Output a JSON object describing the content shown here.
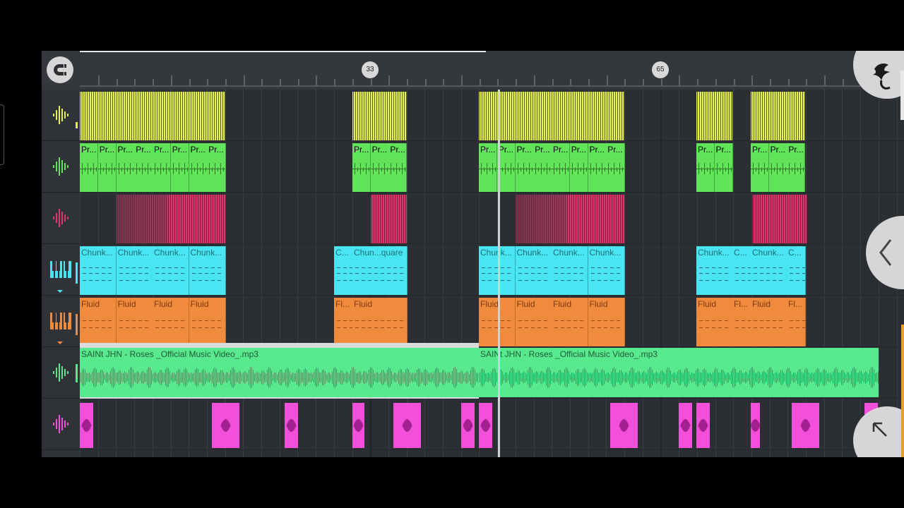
{
  "ruler": {
    "markers": [
      "33",
      "65"
    ]
  },
  "tracks": [
    {
      "name": "audio-track-yellow",
      "color": "#e6f24b",
      "icon": "waveform-icon"
    },
    {
      "name": "audio-track-green",
      "color": "#62e45a",
      "icon": "waveform-icon"
    },
    {
      "name": "audio-track-pink",
      "color": "#e0366e",
      "icon": "waveform-icon"
    },
    {
      "name": "synth-track-cyan",
      "color": "#4ae5f2",
      "icon": "piano-icon"
    },
    {
      "name": "synth-track-orange",
      "color": "#f08a3c",
      "icon": "piano-icon"
    },
    {
      "name": "audio-track-roses",
      "color": "#58e88e",
      "icon": "waveform-icon"
    },
    {
      "name": "audio-track-magenta",
      "color": "#f24fdb",
      "icon": "waveform-icon"
    }
  ],
  "clips": {
    "pattern_labels": [
      "Pr...",
      "Pr...",
      "Pr...",
      "Pr...",
      "Pr...",
      "Pr...",
      "Pr...",
      "Pr...",
      "Pr...",
      "Pr...",
      "Pr...",
      "Pr...",
      "Pr...",
      "Pr...",
      "Pr...",
      "Pr...",
      "Pr...",
      "Pr...",
      "Pr...",
      "Pr...",
      "Pr...",
      "Pr...",
      "Pr...",
      "Pr..."
    ],
    "chunk_labels": [
      "Chunk...",
      "Chunk...",
      "Chunk...",
      "Chunk...",
      "C...",
      "Chun...quare",
      "Chunk...",
      "Chunk...",
      "Chunk...",
      "Chunk...",
      "Chunk...",
      "C...",
      "Chunk...",
      "C..."
    ],
    "fluid_labels": [
      "Fluid",
      "Fluid",
      "Fluid",
      "Fluid",
      "Fl...",
      "Fluid",
      "Fluid",
      "Fluid",
      "Fluid",
      "Fluid",
      "Fluid",
      "Fl...",
      "Fluid",
      "Fl..."
    ],
    "audio_labels": [
      "SAINt JHN - Roses _Official Music Video_.mp3",
      "SAINt JHN - Roses _Official Music Video_.mp3"
    ]
  },
  "buttons": {
    "magnet": "magnet-icon",
    "fl_logo": "fl-studio-logo-icon",
    "collapse": "chevron-left-icon",
    "expand": "arrow-up-left-icon"
  }
}
